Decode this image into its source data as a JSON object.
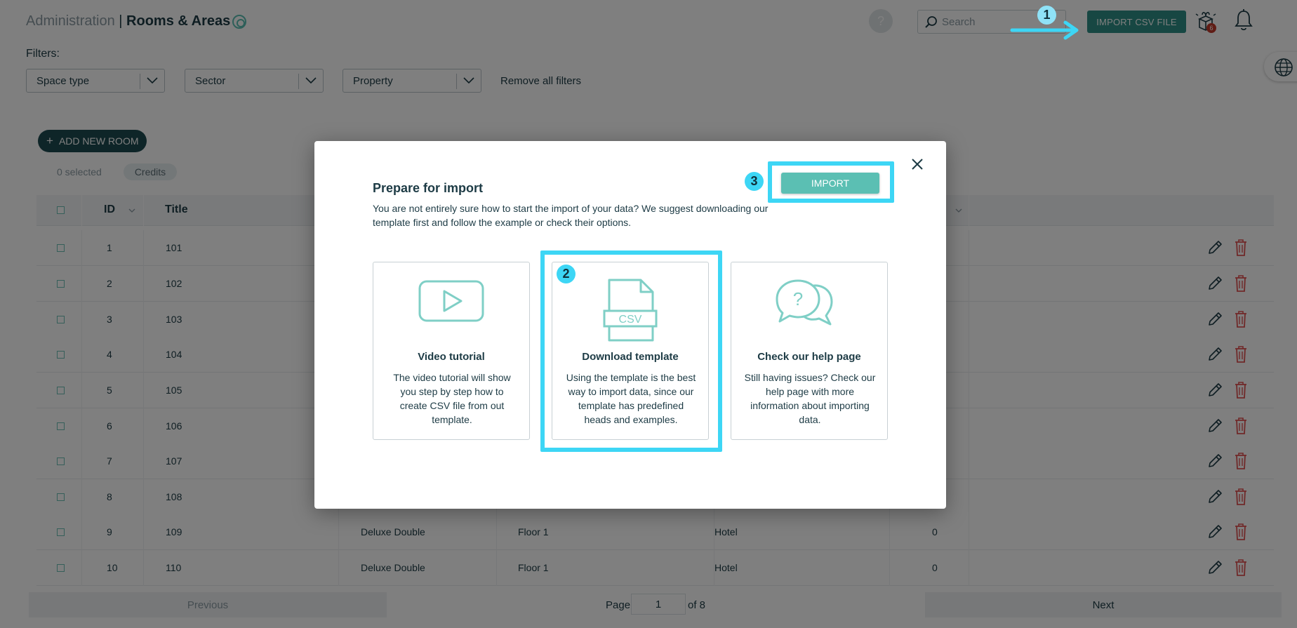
{
  "header": {
    "crumb": "Administration",
    "separator": " | ",
    "title": "Rooms & Areas",
    "help_glyph": "?",
    "search_placeholder": "Search",
    "import_csv_label": "IMPORT CSV FILE",
    "gift_badge": "6"
  },
  "filters": {
    "label": "Filters:",
    "selects": [
      "Space type",
      "Sector",
      "Property"
    ],
    "remove_all": "Remove all filters"
  },
  "toolbar": {
    "add_room_label": "ADD NEW ROOM",
    "add_room_icon": "+",
    "selected": "0 selected",
    "credits": "Credits"
  },
  "table": {
    "headers": {
      "id": "ID",
      "title": "Title"
    },
    "rows": [
      {
        "id": "1",
        "title": "101",
        "type": "",
        "floor": "",
        "property": "",
        "count": ""
      },
      {
        "id": "2",
        "title": "102",
        "type": "",
        "floor": "",
        "property": "",
        "count": ""
      },
      {
        "id": "3",
        "title": "103",
        "type": "",
        "floor": "",
        "property": "",
        "count": ""
      },
      {
        "id": "4",
        "title": "104",
        "type": "",
        "floor": "",
        "property": "",
        "count": ""
      },
      {
        "id": "5",
        "title": "105",
        "type": "",
        "floor": "",
        "property": "",
        "count": ""
      },
      {
        "id": "6",
        "title": "106",
        "type": "",
        "floor": "",
        "property": "",
        "count": ""
      },
      {
        "id": "7",
        "title": "107",
        "type": "",
        "floor": "",
        "property": "",
        "count": ""
      },
      {
        "id": "8",
        "title": "108",
        "type": "",
        "floor": "",
        "property": "",
        "count": ""
      },
      {
        "id": "9",
        "title": "109",
        "type": "Deluxe Double",
        "floor": "Floor 1",
        "property": "Hotel",
        "count": "0"
      },
      {
        "id": "10",
        "title": "110",
        "type": "Deluxe Double",
        "floor": "Floor 1",
        "property": "Hotel",
        "count": "0"
      }
    ]
  },
  "pagination": {
    "previous": "Previous",
    "page_label": "Page",
    "page_value": "1",
    "of_label": "of 8",
    "next": "Next"
  },
  "modal": {
    "title": "Prepare for import",
    "description": "You are not entirely sure how to start the import of your data? We suggest downloading our template first and follow the example or check their options.",
    "import_label": "IMPORT",
    "cards": [
      {
        "icon": "video-play-icon",
        "title": "Video tutorial",
        "desc": "The video tutorial will show you step by step how to create CSV file from out template."
      },
      {
        "icon": "csv-file-icon",
        "icon_text": "CSV",
        "title": "Download template",
        "desc": "Using the template is the best way to import data, since our template has predefined heads and examples."
      },
      {
        "icon": "help-chat-icon",
        "icon_text": "?",
        "title": "Check our help page",
        "desc": "Still having issues? Check our help page with more information about importing data."
      }
    ]
  },
  "annotations": {
    "step1": "1",
    "step2": "2",
    "step3": "3",
    "color": "#3dd6f5"
  },
  "colors": {
    "accent": "#5bbfb3",
    "primary_dark": "#1d4b50",
    "import_header": "#2f8f86",
    "delete": "#e05252"
  }
}
